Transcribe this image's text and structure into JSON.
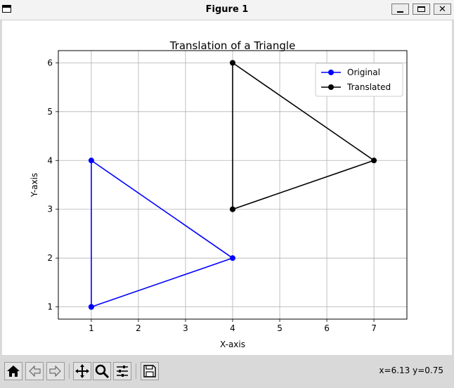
{
  "window": {
    "title": "Figure 1"
  },
  "chart_data": {
    "type": "line",
    "title": "Translation of a Triangle",
    "xlabel": "X-axis",
    "ylabel": "Y-axis",
    "xlim": [
      0.3,
      7.7
    ],
    "ylim": [
      0.75,
      6.25
    ],
    "xticks": [
      1,
      2,
      3,
      4,
      5,
      6,
      7
    ],
    "yticks": [
      1,
      2,
      3,
      4,
      5,
      6
    ],
    "grid": true,
    "legend_position": "upper right",
    "series": [
      {
        "name": "Original",
        "color": "#0000ff",
        "marker": "circle",
        "x": [
          1,
          4,
          1,
          1
        ],
        "y": [
          1,
          2,
          4,
          1
        ]
      },
      {
        "name": "Translated",
        "color": "#000000",
        "marker": "circle",
        "x": [
          4,
          7,
          4,
          4
        ],
        "y": [
          3,
          4,
          6,
          3
        ]
      }
    ]
  },
  "toolbar": {
    "buttons": [
      {
        "icon": "home-icon",
        "name": "home-button"
      },
      {
        "icon": "back-arrow-icon",
        "name": "back-button"
      },
      {
        "icon": "forward-arrow-icon",
        "name": "forward-button"
      },
      {
        "icon": "pan-icon",
        "name": "pan-button"
      },
      {
        "icon": "zoom-icon",
        "name": "zoom-button"
      },
      {
        "icon": "configure-subplots-icon",
        "name": "configure-subplots-button"
      },
      {
        "icon": "save-icon",
        "name": "save-button"
      }
    ],
    "coords": "x=6.13 y=0.75"
  }
}
